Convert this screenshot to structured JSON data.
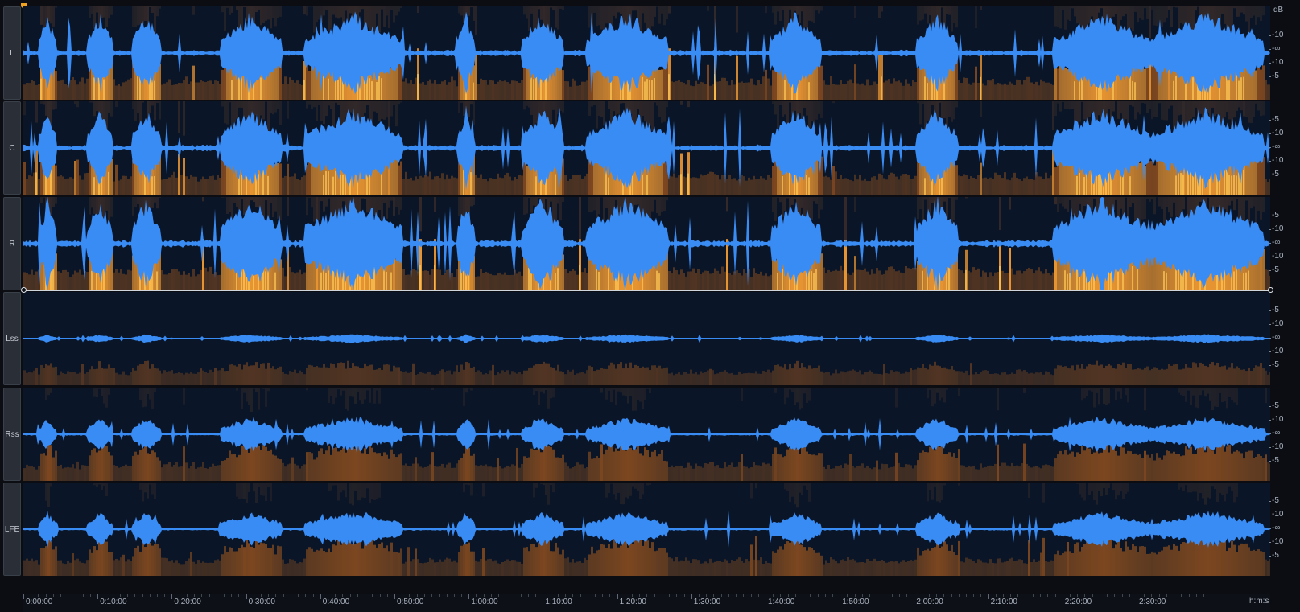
{
  "channels": [
    {
      "id": "L",
      "label": "L",
      "db_top": "dB",
      "ticks": [
        "-10",
        "-∞",
        "-10",
        "-5"
      ],
      "energy": 1.0
    },
    {
      "id": "C",
      "label": "C",
      "db_top": "",
      "ticks": [
        "-5",
        "-10",
        "-∞",
        "-10",
        "-5"
      ],
      "energy": 1.0
    },
    {
      "id": "R",
      "label": "R",
      "db_top": "",
      "ticks": [
        "-5",
        "-10",
        "-∞",
        "-10",
        "-5"
      ],
      "energy": 1.1
    },
    {
      "id": "Lss",
      "label": "Lss",
      "db_top": "",
      "ticks": [
        "-5",
        "-10",
        "-∞",
        "-10",
        "-5"
      ],
      "energy": 0.25
    },
    {
      "id": "Rss",
      "label": "Rss",
      "db_top": "",
      "ticks": [
        "-5",
        "-10",
        "-∞",
        "-10",
        "-5"
      ],
      "energy": 0.6
    },
    {
      "id": "LFE",
      "label": "LFE",
      "db_top": "",
      "ticks": [
        "-5",
        "-10",
        "-∞",
        "-10",
        "-5"
      ],
      "energy": 0.6
    }
  ],
  "timeline": {
    "labels": [
      "0:00:00",
      "0:10:00",
      "0:20:00",
      "0:30:00",
      "0:40:00",
      "0:50:00",
      "1:00:00",
      "1:10:00",
      "1:20:00",
      "1:30:00",
      "1:40:00",
      "1:50:00",
      "2:00:00",
      "2:10:00",
      "2:20:00",
      "2:30:00"
    ],
    "unit": "h:m:s"
  },
  "colors": {
    "waveform": "#3a8cf5",
    "spectrogram_low": "#0a1628",
    "spectrogram_mid": "#c86a1e",
    "spectrogram_high": "#ffb23d",
    "playhead": "#f0a21e",
    "background": "#0b0d12"
  },
  "icons": {
    "playhead": "playhead-marker-icon",
    "selection_handle": "selection-handle-icon"
  }
}
